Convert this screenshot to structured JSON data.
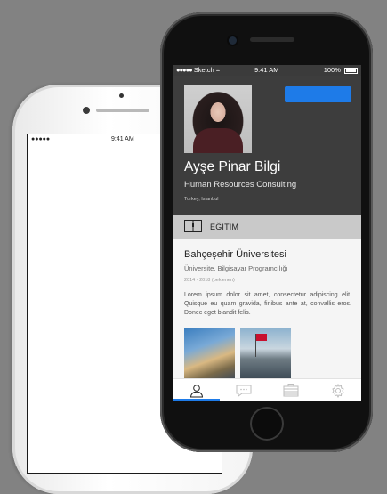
{
  "back_phone": {
    "status_time": "9:41 AM"
  },
  "status_bar": {
    "carrier": "Sketch",
    "time": "9:41 AM",
    "battery": "100%"
  },
  "profile": {
    "name": "Ayşe Pinar Bilgi",
    "title": "Human Resources Consulting",
    "location": "Turkey, Istanbul"
  },
  "section": {
    "title": "EĞITİM",
    "icon": "book-icon"
  },
  "education": {
    "school": "Bahçeşehir Üniversitesi",
    "degree": "Üniversite, Bilgisayar Programcılığı",
    "dates": "2014 - 2018 (beklenen)",
    "description": "Lorem ipsum dolor sit amet, consectetur adipiscing elit. Quisque eu quam gravida, finibus ante at, convallis eros. Donec eget blandit felis."
  },
  "tabs": [
    {
      "icon": "profile-icon",
      "active": true
    },
    {
      "icon": "chat-icon",
      "active": false
    },
    {
      "icon": "briefcase-icon",
      "active": false
    },
    {
      "icon": "gear-icon",
      "active": false
    }
  ],
  "colors": {
    "accent": "#1e7be8",
    "header_bg": "#3d3d3d",
    "section_bg": "#c9c9c9"
  }
}
